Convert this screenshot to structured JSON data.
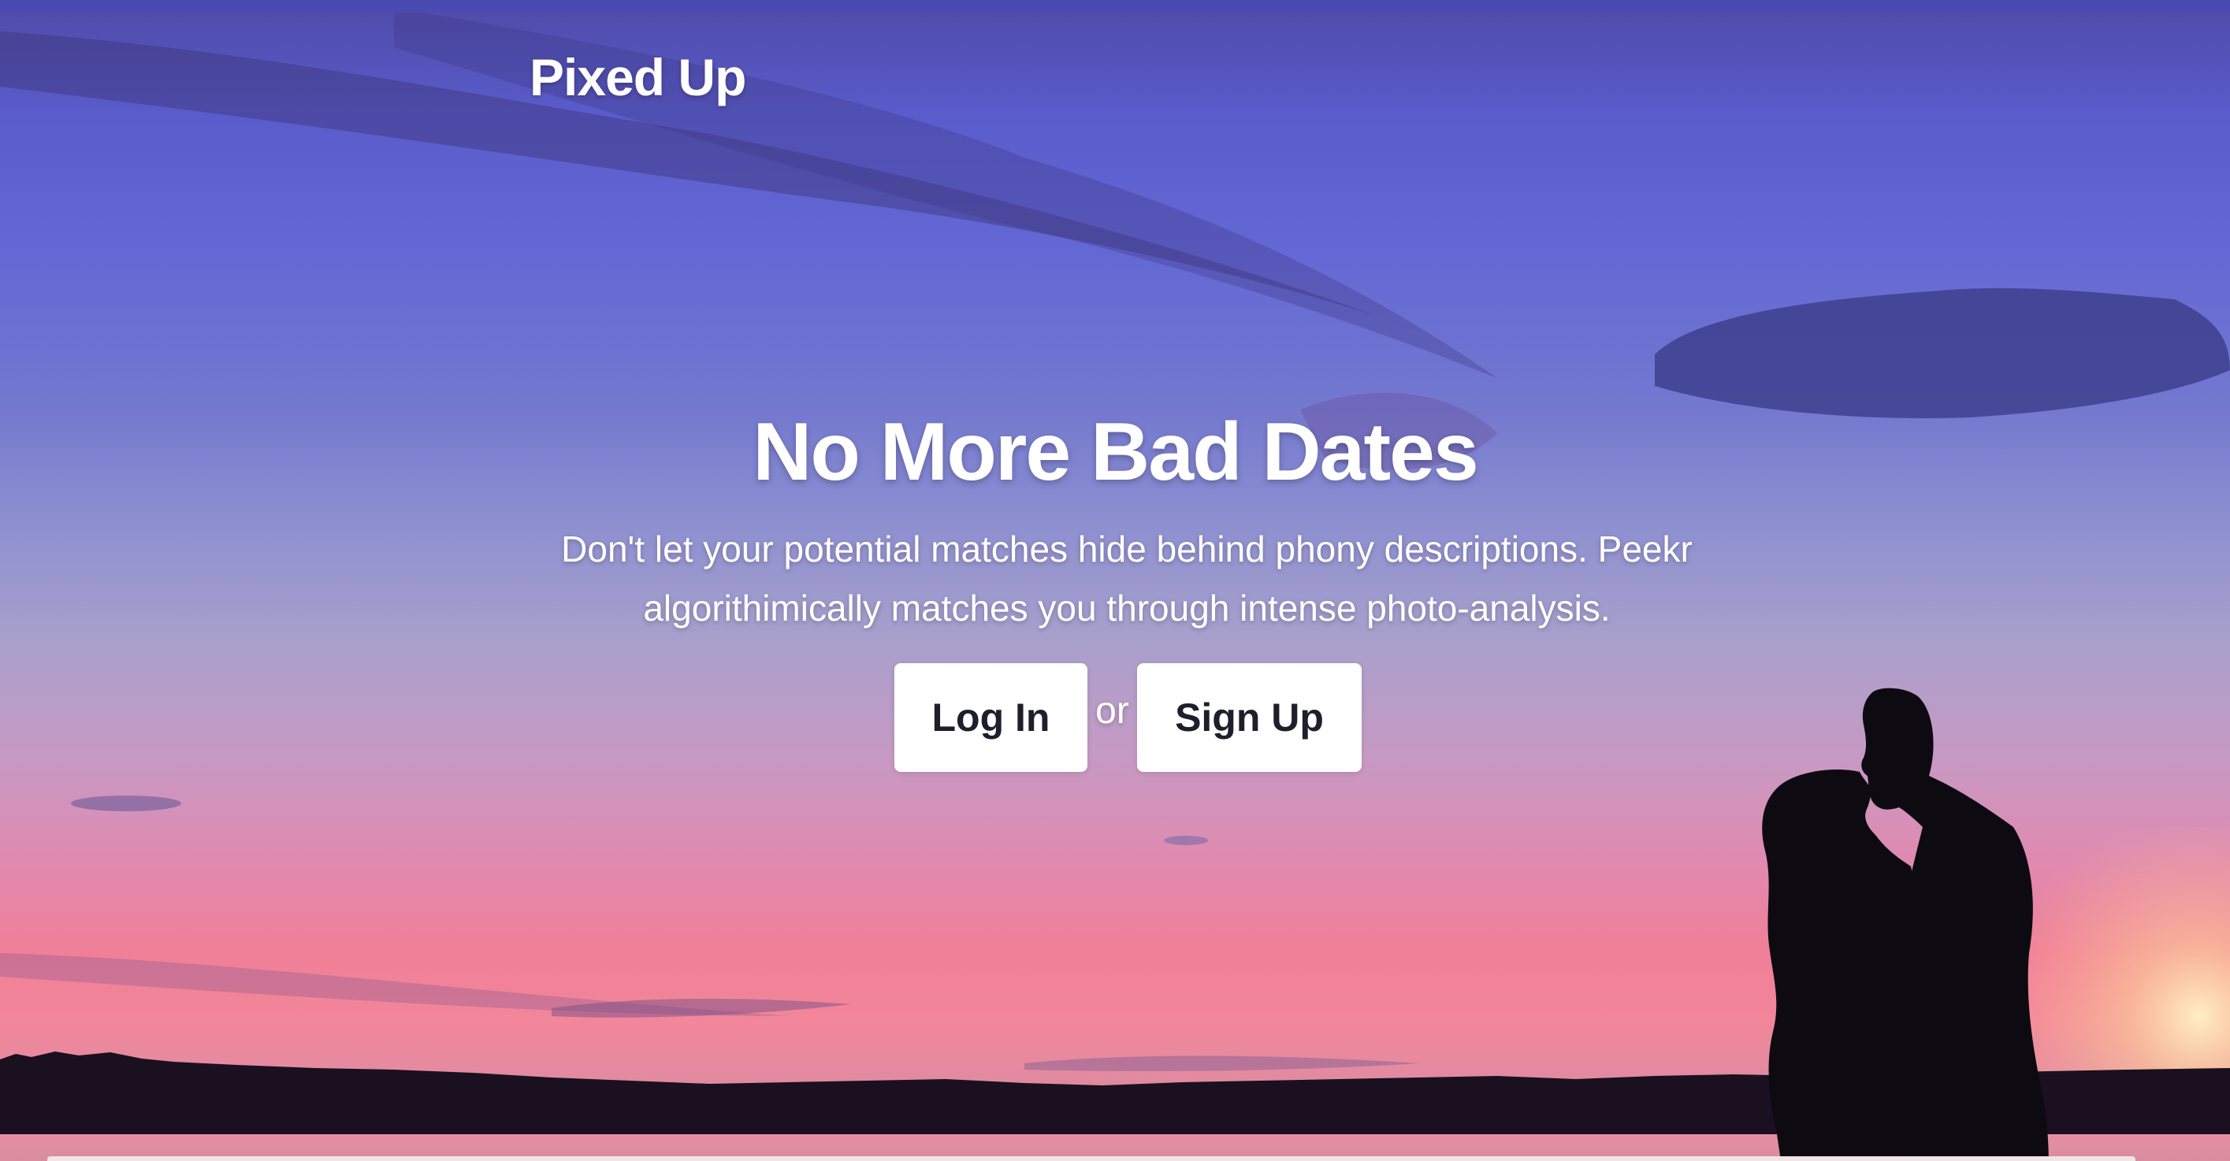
{
  "brand": {
    "name": "Pixed Up"
  },
  "hero": {
    "headline": "No More Bad Dates",
    "subline": "Don't let your potential matches hide behind phony descriptions. Peekr algorithimically matches you through intense photo-analysis.",
    "login_label": "Log In",
    "or_label": "or",
    "signup_label": "Sign Up"
  },
  "colors": {
    "sky_top": "#4e4aa6",
    "sky_mid": "#8d8fd0",
    "sky_sunset": "#f07f98",
    "button_bg": "#ffffff",
    "button_text": "#1f1f2b",
    "text": "#ffffff"
  }
}
